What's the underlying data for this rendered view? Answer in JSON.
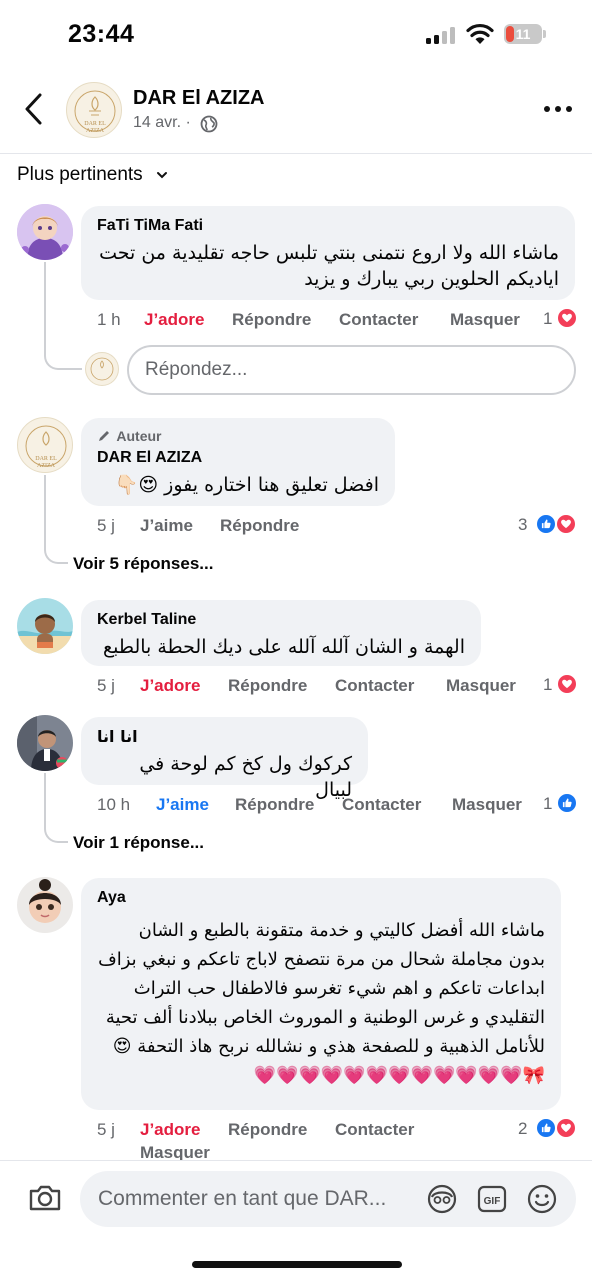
{
  "status": {
    "time": "23:44",
    "battery": "11"
  },
  "header": {
    "page_name": "DAR El AZIZA",
    "date": "14 avr. ·"
  },
  "sort": {
    "label": "Plus pertinents"
  },
  "comments": [
    {
      "author": "FaTi TiMa Fati",
      "text": "ماشاء الله ولا اروع نتمنى بنتي تلبس حاجه تقليدية من تحت اياديكم الحلوين ربي يبارك و يزيد",
      "time": "1 h",
      "react_label": "J’adore",
      "reply": "Répondre",
      "contact": "Contacter",
      "hide": "Masquer",
      "count": "1"
    },
    {
      "badge": "Auteur",
      "author": "DAR El AZIZA",
      "text": "افضل تعليق هنا اختاره يفوز 😍👇🏻",
      "time": "5 j",
      "react_label": "J’aime",
      "reply": "Répondre",
      "count": "3",
      "see_replies": "Voir 5 réponses..."
    },
    {
      "author": "Kerbel Taline",
      "text": "الهمة و  الشان آلله آلله على ديك الحطة  بالطبع",
      "time": "5 j",
      "react_label": "J’adore",
      "reply": "Répondre",
      "contact": "Contacter",
      "hide": "Masquer",
      "count": "1"
    },
    {
      "author": "انا انا",
      "text": "كركوك ول كخ كم لوحة في لبيال",
      "time": "10 h",
      "react_label": "J’aime",
      "reply": "Répondre",
      "contact": "Contacter",
      "hide": "Masquer",
      "count": "1",
      "see_replies": "Voir 1 réponse..."
    },
    {
      "author": "Aya",
      "text": "ماشاء الله أفضل كاليتي و خدمة متقونة بالطبع و الشان بدون مجاملة شحال من مرة نتصفح لاباج تاعكم و نبغي بزاف ابداعات تاعكم و اهم شيء تغرسو فالاطفال حب التراث التقليدي و غرس الوطنية و الموروث الخاص ببلادنا ألف تحية للأنامل الذهبية و للصفحة هذي و نشالله نربح هاذ التحفة 😍🎀💗💗💗💗💗💗💗💗💗💗💗💗",
      "time": "5 j",
      "react_label": "J’adore",
      "reply": "Répondre",
      "contact": "Contacter",
      "hide": "Masquer",
      "count": "2"
    }
  ],
  "reply_box": {
    "placeholder": "Répondez..."
  },
  "composer": {
    "placeholder": "Commenter en tant que DAR..."
  },
  "colors": {
    "love": "#e41e3f",
    "like": "#1877f2",
    "bubble": "#f0f2f5",
    "meta": "#65676b"
  }
}
